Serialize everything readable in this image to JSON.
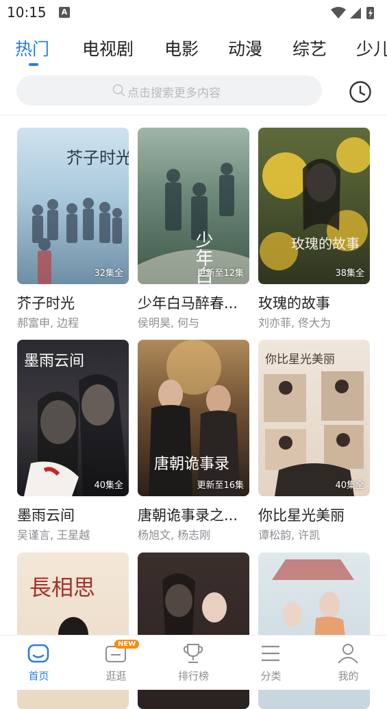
{
  "status_bar": {
    "time": "10:15",
    "notification_letter": "A"
  },
  "tabs": [
    {
      "label": "热门",
      "active": true
    },
    {
      "label": "电视剧"
    },
    {
      "label": "电影"
    },
    {
      "label": "动漫"
    },
    {
      "label": "综艺"
    },
    {
      "label": "少儿"
    }
  ],
  "search": {
    "placeholder": "点击搜索更多内容"
  },
  "items": [
    {
      "title": "芥子时光",
      "cast": "郝富申, 边程",
      "episodes": "32集全",
      "poster_text": "芥子时光"
    },
    {
      "title": "少年白马醉春...",
      "cast": "侯明昊, 何与",
      "episodes": "更新至12集",
      "poster_text": "少年白马"
    },
    {
      "title": "玫瑰的故事",
      "cast": "刘亦菲, 佟大为",
      "episodes": "38集全",
      "poster_text": "玫瑰的故事"
    },
    {
      "title": "墨雨云间",
      "cast": "吴谨言, 王星越",
      "episodes": "40集全",
      "poster_text": "墨雨云间"
    },
    {
      "title": "唐朝诡事录之...",
      "cast": "杨旭文, 杨志刚",
      "episodes": "更新至16集",
      "poster_text": "唐朝诡事录"
    },
    {
      "title": "你比星光美丽",
      "cast": "谭松韵, 许凯",
      "episodes": "40集全",
      "poster_text": "你比星光美丽"
    },
    {
      "title": "",
      "cast": "",
      "episodes": "",
      "poster_text": "長相思"
    },
    {
      "title": "",
      "cast": "",
      "episodes": "",
      "poster_text": ""
    },
    {
      "title": "",
      "cast": "",
      "episodes": "",
      "poster_text": ""
    }
  ],
  "bottom_nav": [
    {
      "label": "首页",
      "icon": "home-icon",
      "active": true
    },
    {
      "label": "逛逛",
      "icon": "browse-icon",
      "badge": "NEW"
    },
    {
      "label": "排行榜",
      "icon": "trophy-icon"
    },
    {
      "label": "分类",
      "icon": "category-icon"
    },
    {
      "label": "我的",
      "icon": "profile-icon"
    }
  ],
  "colors": {
    "accent": "#2a7de1",
    "badge": "#ff8a00"
  }
}
